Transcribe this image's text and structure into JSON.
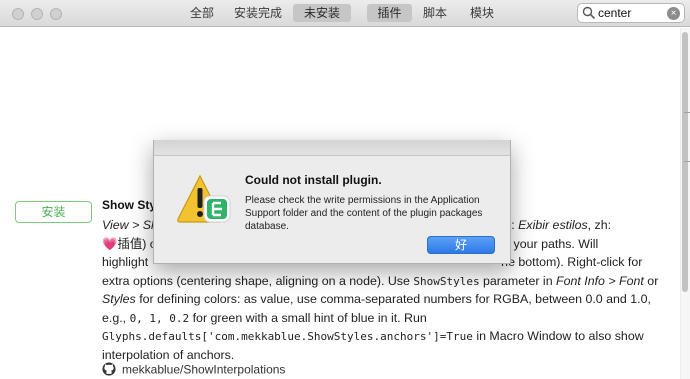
{
  "toolbar": {
    "filter_tabs": [
      "全部",
      "安装完成",
      "未安装"
    ],
    "selected_filter": "未安装",
    "category_tabs": [
      "插件",
      "脚本",
      "模块"
    ],
    "selected_category": "插件",
    "search": {
      "value": "center",
      "clear_icon": "×"
    }
  },
  "plugin": {
    "install_label": "安装",
    "title": "Show Sty",
    "repo": "mekkablue/ShowInterpolations",
    "desc": {
      "l1_a": "View > Sh",
      "l1_b": "es, pt: ",
      "l1_c": "Exibir estilos",
      "l1_d": ", zh:",
      "l2_a": "💗",
      "l2_b": "插值) o",
      "l2_c": "hind your paths. Will",
      "l3_a": "highlight",
      "l3_b": "he bottom). Right-click for",
      "l4_a": "extra options (centering shape, aligning on a node). Use ",
      "l4_b": "ShowStyles",
      "l4_c": " parameter in ",
      "l4_d": "Font Info > Font",
      "l4_e": " or",
      "l5_a": "Styles",
      "l5_b": " for defining colors: as value, use comma-separated numbers for RGBA, between 0.0 and 1.0,",
      "l6_a": "e.g., ",
      "l6_b": "0, 1, 0.2",
      "l6_c": " for green with a small hint of blue in it. Run",
      "l7_a": "Glyphs.defaults['com.mekkablue.ShowStyles.anchors']=True",
      "l7_b": " in Macro Window to also show",
      "l8": "interpolation of anchors."
    }
  },
  "dialog": {
    "title": "Could not install plugin.",
    "message": "Please check the write permissions in the Application Support folder and the content of the plugin packages database.",
    "ok_label": "好"
  },
  "colors": {
    "install_green": "#4caf50",
    "ok_blue": "#2a78e6",
    "alert_yellow": "#f2c230",
    "glyphs_green": "#2fb36a"
  }
}
